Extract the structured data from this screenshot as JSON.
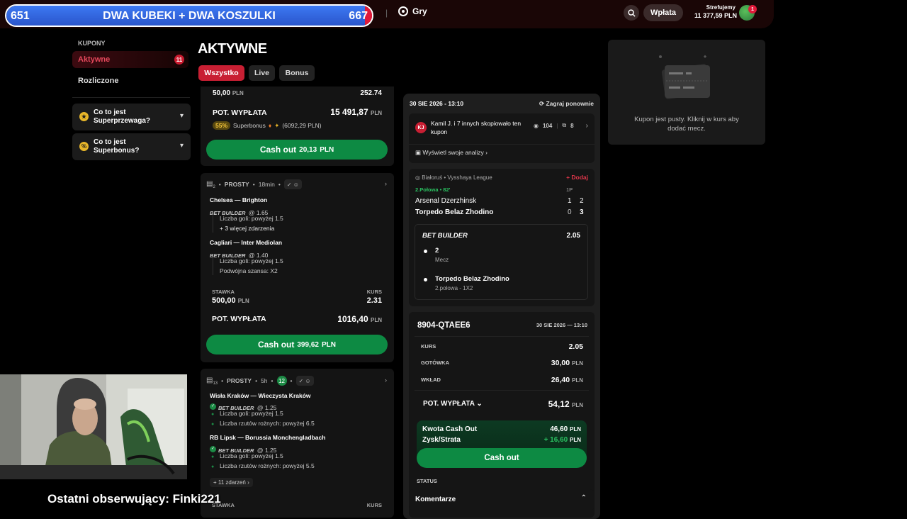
{
  "stream": {
    "goal_left": "651",
    "goal_title": "DWA KUBEKI + DWA KOSZULKI",
    "goal_right": "667",
    "goal_progress": 0.98,
    "follower": "Ostatni obserwujący: Finki221"
  },
  "header": {
    "nav_games": "Gry",
    "deposit": "Wpłata",
    "username": "Strefujemy",
    "balance": "11 377,59 PLN",
    "notif_count": "1"
  },
  "sidebar": {
    "section": "KUPONY",
    "active_label": "Aktywne",
    "active_count": "11",
    "settled_label": "Rozliczone",
    "faq1": "Co to jest Superprzewaga?",
    "faq2": "Co to jest Superbonus?"
  },
  "page": {
    "title": "AKTYWNE",
    "tabs": [
      "Wszystko",
      "Live",
      "Bonus"
    ]
  },
  "card1": {
    "stake": "50,00",
    "odds": "252.74",
    "payout_label": "POT. WYPŁATA",
    "payout": "15 491,87",
    "superbonus_pct": "55%",
    "superbonus_text": "Superbonus",
    "superbonus_amount": "(6092,29 PLN)",
    "cashout_label": "Cash out",
    "cashout_value": "20,13"
  },
  "card2": {
    "count": "2",
    "type": "PROSTY",
    "time": "18min",
    "match1": "Chelsea — Brighton",
    "bb1": "BET BUILDER",
    "odd1": "@ 1.65",
    "sel1": "Liczba goli: powyżej 1.5",
    "more1": "+ 3 więcej zdarzenia",
    "match2": "Cagliari — Inter Mediolan",
    "bb2": "BET BUILDER",
    "odd2": "@ 1.40",
    "sel2a": "Liczba goli: powyżej 1.5",
    "sel2b": "Podwójna szansa: X2",
    "stake_label": "STAWKA",
    "odds_label": "KURS",
    "stake": "500,00",
    "odds": "2.31",
    "payout_label": "POT. WYPŁATA",
    "payout": "1016,40",
    "cashout_label": "Cash out",
    "cashout_value": "399,62"
  },
  "card3": {
    "count": "13",
    "type": "PROSTY",
    "time": "5h",
    "badge": "12",
    "match1": "Wisła Kraków — Wieczysta Kraków",
    "bb1": "BET BUILDER",
    "odd1": "@ 1.25",
    "sel1a": "Liczba goli: powyżej 1.5",
    "sel1b": "Liczba rzutów rożnych: powyżej 6.5",
    "match2": "RB Lipsk — Borussia Monchengladbach",
    "bb2": "BET BUILDER",
    "odd2": "@ 1.25",
    "sel2a": "Liczba goli: powyżej 1.5",
    "sel2b": "Liczba rzutów rożnych: powyżej 5.5",
    "more": "+ 11 zdarzeń",
    "stake_label": "STAWKA",
    "odds_label": "KURS"
  },
  "detail": {
    "date": "30 SIE 2026 - 13:10",
    "replay": "Zagraj ponownie",
    "copied_text": "Kamil J. i 7 innych skopiowało ten kupon",
    "views": "104",
    "copies": "8",
    "analysis": "Wyświetl swoje analizy",
    "league": "Białoruś • Vysshaya League",
    "add": "+ Dodaj",
    "period": "2.Połowa • 82'",
    "col_1p": "1P",
    "team1": "Arsenal Dzerzhinsk",
    "team1_1p": "1",
    "team1_score": "2",
    "team2": "Torpedo Belaz Zhodino",
    "team2_1p": "0",
    "team2_score": "3",
    "bb_label": "BET BUILDER",
    "bb_odds": "2.05",
    "pick1": "2",
    "pick1_sub": "Mecz",
    "pick2": "Torpedo Belaz Zhodino",
    "pick2_sub": "2.połowa - 1X2",
    "code": "8904-QTAEE6",
    "code_date": "30 SIE 2026 — 13:10",
    "kurs_label": "KURS",
    "kurs": "2.05",
    "cash_label": "GOTÓWKA",
    "cash": "30,00",
    "wklad_label": "WKŁAD",
    "wklad": "26,40",
    "payout_label": "POT. WYPŁATA",
    "payout": "54,12",
    "currency": "PLN",
    "co_amount_label": "Kwota Cash Out",
    "co_amount": "46,60",
    "profit_label": "Zysk/Strata",
    "profit": "+ 16,60",
    "cashout_btn": "Cash out",
    "status_label": "STATUS",
    "comments": "Komentarze"
  },
  "empty": {
    "text": "Kupon jest pusty. Kliknij w kurs aby dodać mecz."
  },
  "currency": "PLN"
}
